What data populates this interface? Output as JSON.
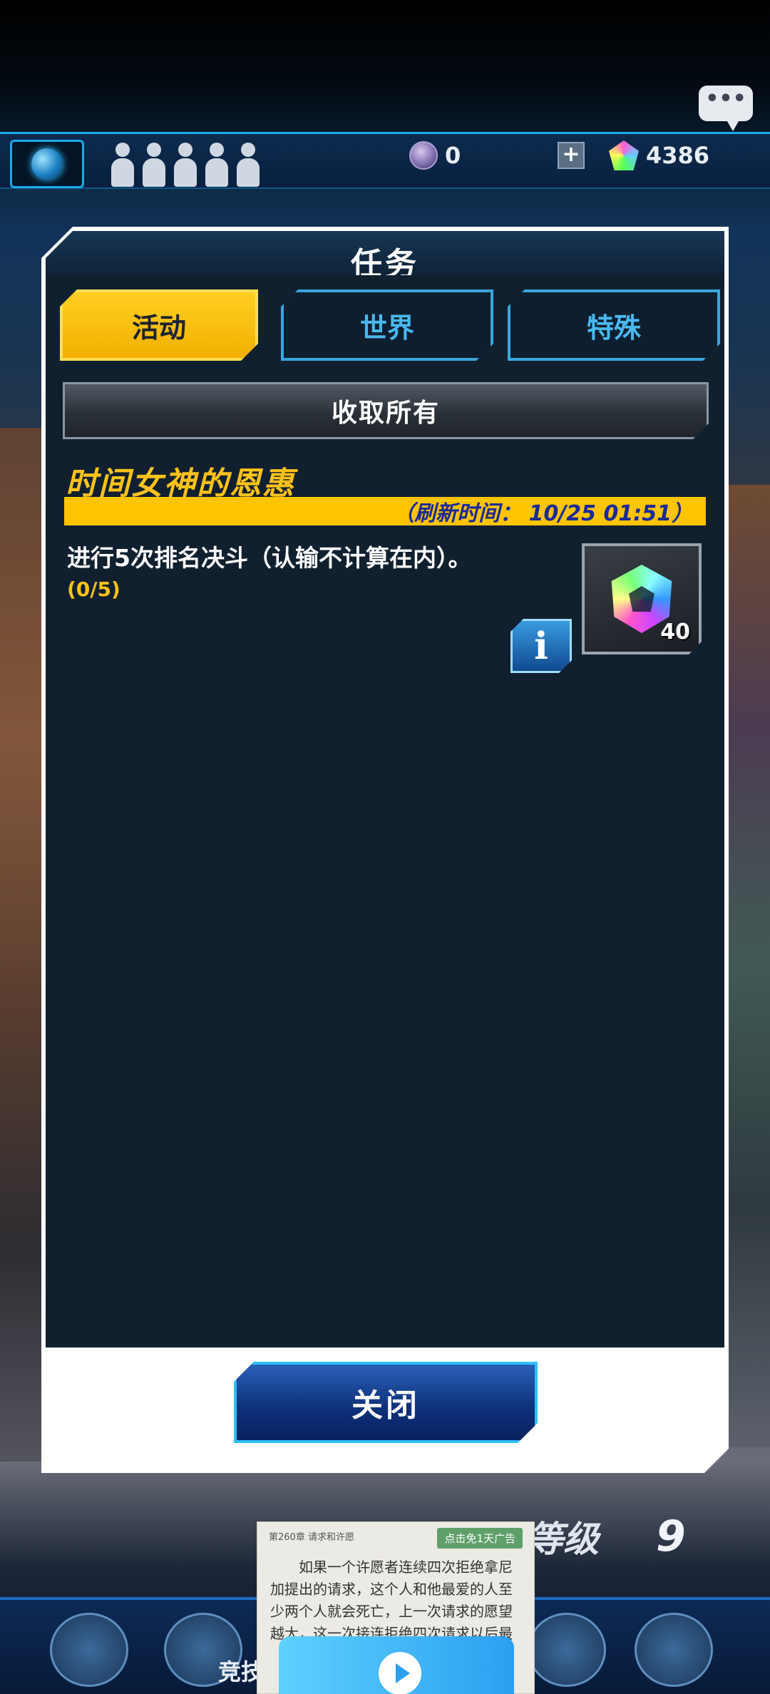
{
  "hud": {
    "orb_count": "0",
    "gem_count": "4386"
  },
  "dialog": {
    "title": "任务",
    "tabs": [
      {
        "label": "活动",
        "active": true
      },
      {
        "label": "世界",
        "active": false
      },
      {
        "label": "特殊",
        "active": false
      }
    ],
    "collect_all_label": "收取所有",
    "quest": {
      "title": "时间女神的恩惠",
      "refresh": "（刷新时间： 10/25 01:51）",
      "description": "进行5次排名决斗（认输不计算在内）。",
      "progress": "(0/5)",
      "reward_count": "40",
      "info_label": "i"
    },
    "close_label": "关闭"
  },
  "bottom": {
    "level_label": "等级",
    "level_value": "9",
    "nav_label": "竞技"
  },
  "ad": {
    "chapter": "第260章 请求和许愿",
    "skip_label": "点击免1天广告",
    "text": "如果一个许愿者连续四次拒绝拿尼加提出的请求，这个人和他最爱的人至少两个人就会死亡，上一次请求的愿望越大，这一次接连拒绝四次请求以后最"
  },
  "colors": {
    "accent_yellow": "#ffc400",
    "tab_blue": "#39a6de",
    "panel_bg": "#11202f",
    "refresh_text": "#1a2a9a"
  }
}
